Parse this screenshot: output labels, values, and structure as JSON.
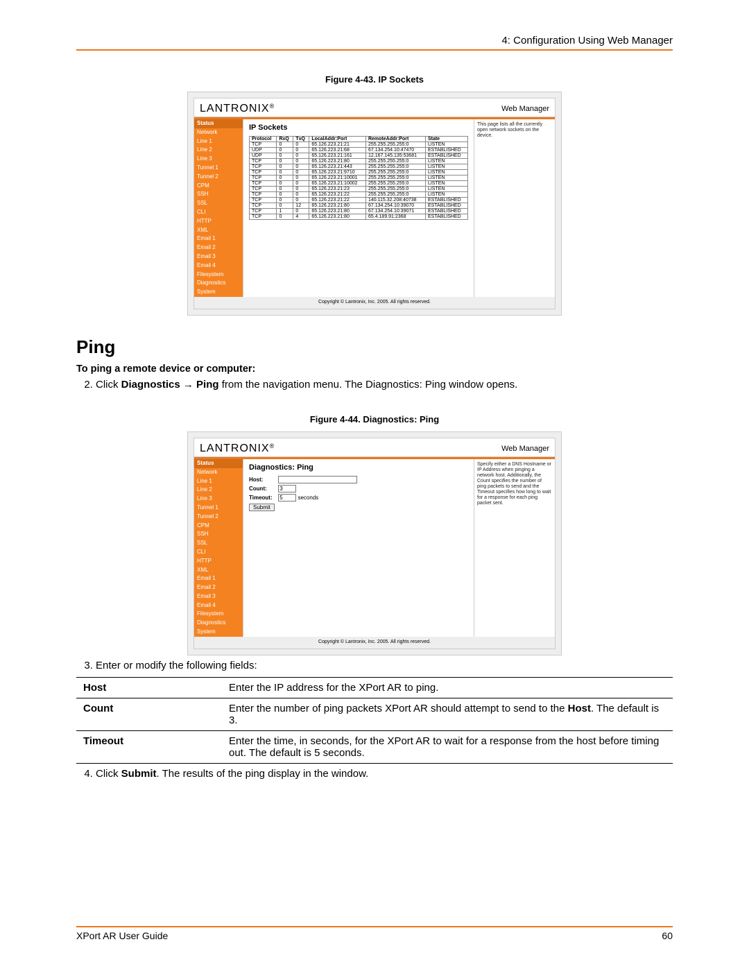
{
  "header": {
    "right": "4: Configuration Using Web Manager"
  },
  "fig43": {
    "caption": "Figure 4-43. IP Sockets",
    "brand_left": "LANTRONIX",
    "brand_tm": "®",
    "brand_right": "Web Manager",
    "main_title": "IP Sockets",
    "side_text": "This page lists all the currently open network sockets on the device.",
    "nav": [
      "Status",
      "Network",
      "Line 1",
      "Line 2",
      "Line 3",
      "Tunnel 1",
      "Tunnel 2",
      "CPM",
      "SSH",
      "SSL",
      "CLI",
      "HTTP",
      "XML",
      "Email 1",
      "Email 2",
      "Email 3",
      "Email 4",
      "Filesystem",
      "Diagnostics",
      "System"
    ],
    "columns": [
      "Protocol",
      "RxQ",
      "TxQ",
      "LocalAddr:Port",
      "RemoteAddr:Port",
      "State"
    ],
    "rows": [
      [
        "TCP",
        "0",
        "0",
        "65.126.223.21:21",
        "255.255.255.255:0",
        "LISTEN"
      ],
      [
        "UDP",
        "0",
        "0",
        "65.126.223.21:68",
        "67.134.254.10:47470",
        "ESTABLISHED"
      ],
      [
        "UDP",
        "0",
        "0",
        "65.126.223.21:161",
        "12.167.145.135:53681",
        "ESTABLISHED"
      ],
      [
        "TCP",
        "0",
        "0",
        "65.126.223.21:80",
        "255.255.255.255:0",
        "LISTEN"
      ],
      [
        "TCP",
        "0",
        "0",
        "65.126.223.21:443",
        "255.255.255.255:0",
        "LISTEN"
      ],
      [
        "TCP",
        "0",
        "0",
        "65.126.223.21:9710",
        "255.255.255.255:0",
        "LISTEN"
      ],
      [
        "TCP",
        "0",
        "0",
        "65.126.223.21:10001",
        "255.255.255.255:0",
        "LISTEN"
      ],
      [
        "TCP",
        "0",
        "0",
        "65.126.223.21:10002",
        "255.255.255.255:0",
        "LISTEN"
      ],
      [
        "TCP",
        "0",
        "0",
        "65.126.223.21:23",
        "255.255.255.255:0",
        "LISTEN"
      ],
      [
        "TCP",
        "0",
        "0",
        "65.126.223.21:22",
        "255.255.255.255:0",
        "LISTEN"
      ],
      [
        "TCP",
        "0",
        "0",
        "65.126.223.21:22",
        "140.115.32.208:40738",
        "ESTABLISHED"
      ],
      [
        "TCP",
        "0",
        "12",
        "65.126.223.21:80",
        "67.134.254.10:39070",
        "ESTABLISHED"
      ],
      [
        "TCP",
        "1",
        "0",
        "65.126.223.21:80",
        "67.134.254.10:39071",
        "ESTABLISHED"
      ],
      [
        "TCP",
        "0",
        "4",
        "65.126.223.21:80",
        "65.4.189.91:2368",
        "ESTABLISHED"
      ]
    ],
    "foot": "Copyright © Lantronix, Inc. 2005. All rights reserved."
  },
  "ping": {
    "h1": "Ping",
    "sub": "To ping a remote device or computer:",
    "step2_a": "Click ",
    "step2_b1": "Diagnostics",
    "step2_arrow": " → ",
    "step2_b2": "Ping",
    "step2_c": " from the navigation menu. The Diagnostics: Ping window opens."
  },
  "fig44": {
    "caption": "Figure 4-44. Diagnostics: Ping",
    "brand_left": "LANTRONIX",
    "brand_tm": "®",
    "brand_right": "Web Manager",
    "main_title": "Diagnostics: Ping",
    "side_text": "Specify either a DNS Hostname or IP Address when pinging a network host. Additionally, the Count specifies the number of ping packets to send and the Timeout specifies how long to wait for a response for each ping packet sent.",
    "nav": [
      "Status",
      "Network",
      "Line 1",
      "Line 2",
      "Line 3",
      "Tunnel 1",
      "Tunnel 2",
      "CPM",
      "SSH",
      "SSL",
      "CLI",
      "HTTP",
      "XML",
      "Email 1",
      "Email 2",
      "Email 3",
      "Email 4",
      "Filesystem",
      "Diagnostics",
      "System"
    ],
    "form": {
      "host_label": "Host:",
      "host_value": "",
      "count_label": "Count:",
      "count_value": "3",
      "timeout_label": "Timeout:",
      "timeout_value": "5",
      "timeout_unit": "seconds",
      "submit": "Submit"
    },
    "foot": "Copyright © Lantronix, Inc. 2005. All rights reserved."
  },
  "step3": "Enter or modify the following fields:",
  "fields_table": {
    "host": {
      "name": "Host",
      "desc_a": "Enter the IP address for the XPort AR to ping."
    },
    "count": {
      "name": "Count",
      "desc_a": "Enter the number of ping packets XPort AR should attempt to send to the ",
      "desc_bold": "Host",
      "desc_b": ". The default is 3."
    },
    "timeout": {
      "name": "Timeout",
      "desc_a": "Enter the time, in seconds, for the XPort AR to wait for a response from the host before timing out. The default is 5 seconds."
    }
  },
  "step4_a": "Click ",
  "step4_bold": "Submit",
  "step4_b": ". The results of the ping display in the window.",
  "footer": {
    "left": "XPort AR User Guide",
    "right": "60"
  }
}
